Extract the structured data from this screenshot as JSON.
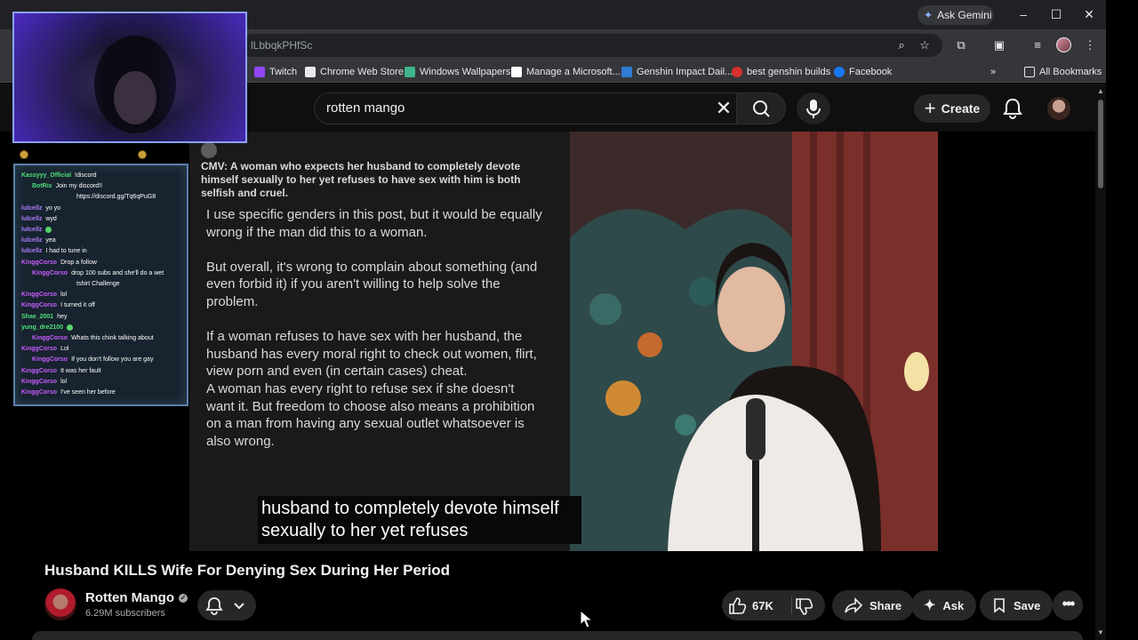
{
  "browser": {
    "url_fragment": "lLbbqkPHfSc",
    "ask_gemini_label": "Ask Gemini",
    "bookmarks": [
      "Twitch",
      "Chrome Web Store",
      "Windows Wallpapers",
      "Manage a Microsoft...",
      "Genshin Impact Dail...",
      "best genshin builds",
      "Facebook"
    ],
    "all_bookmarks_label": "All Bookmarks",
    "overflow_label": "»"
  },
  "youtube": {
    "search_query": "rotten mango",
    "create_label": "Create",
    "video": {
      "reddit_title": "CMV: A woman who expects her husband to completely devote himself sexually to her yet refuses to have sex with him is both selfish and cruel.",
      "reddit_paragraphs": [
        "I use specific genders in this post, but it would be equally wrong if the man did this to a woman.",
        "But overall, it's wrong to complain about something (and even forbid it) if you aren't willing to help solve the problem.",
        "If a woman refuses to have sex with her husband, the husband has every moral right to check out women, flirt, view porn and even (in certain cases) cheat.",
        "A woman has every right to refuse sex if she doesn't want it. But freedom to choose also means a prohibition on a man from having any sexual outlet whatsoever is also wrong."
      ],
      "caption_line1": "husband to completely devote himself",
      "caption_line2": "sexually to her yet refuses"
    },
    "title": "Husband KILLS Wife For Denying Sex During Her Period",
    "channel": {
      "name": "Rotten Mango",
      "subscribers": "6.29M subscribers"
    },
    "actions": {
      "likes": "67K",
      "share": "Share",
      "ask": "Ask",
      "save": "Save"
    }
  },
  "stream_chat": [
    {
      "user": "Kassyyy_Official",
      "text": "!discord",
      "color": "#4ee07a",
      "kind": "msg"
    },
    {
      "user": "BotRix",
      "text": "Join my discord!!",
      "color": "#4ee07a",
      "kind": "bot"
    },
    {
      "user": "",
      "text": "https://discord.gg/Tq6qPuG8",
      "color": "#ffffff",
      "kind": "cont"
    },
    {
      "user": "lulcellz",
      "text": "yo yo",
      "color": "#b07cff",
      "kind": "msg"
    },
    {
      "user": "lulcellz",
      "text": "wyd",
      "color": "#b07cff",
      "kind": "msg"
    },
    {
      "user": "lulcellz",
      "text": "",
      "color": "#b07cff",
      "kind": "emote"
    },
    {
      "user": "lulcellz",
      "text": "yea",
      "color": "#b07cff",
      "kind": "msg"
    },
    {
      "user": "lulcellz",
      "text": "I had to tune in",
      "color": "#b07cff",
      "kind": "msg"
    },
    {
      "user": "KinggCorso",
      "text": "Drop a follow",
      "color": "#c85cff",
      "kind": "msg"
    },
    {
      "user": "KinggCorso",
      "text": "drop 100 subs and she'll do a wet",
      "color": "#c85cff",
      "kind": "reply"
    },
    {
      "user": "",
      "text": "tshirt Challenge",
      "color": "#ffffff",
      "kind": "cont"
    },
    {
      "user": "KinggCorso",
      "text": "lol",
      "color": "#c85cff",
      "kind": "msg"
    },
    {
      "user": "KinggCorso",
      "text": "I turned it off",
      "color": "#c85cff",
      "kind": "msg"
    },
    {
      "user": "Shae_2001",
      "text": "hey",
      "color": "#4ee07a",
      "kind": "msg"
    },
    {
      "user": "yung_dre2100",
      "text": "",
      "color": "#4ee07a",
      "kind": "emote"
    },
    {
      "user": "KinggCorso",
      "text": "Whats this chink talking about",
      "color": "#c85cff",
      "kind": "reply"
    },
    {
      "user": "KinggCorso",
      "text": "Lol",
      "color": "#c85cff",
      "kind": "msg"
    },
    {
      "user": "KinggCorso",
      "text": "If you don't follow you are gay",
      "color": "#c85cff",
      "kind": "reply"
    },
    {
      "user": "KinggCorso",
      "text": "It was her fault",
      "color": "#c85cff",
      "kind": "msg"
    },
    {
      "user": "KinggCorso",
      "text": "lol",
      "color": "#c85cff",
      "kind": "msg"
    },
    {
      "user": "KinggCorso",
      "text": "I've seen her before",
      "color": "#c85cff",
      "kind": "msg"
    }
  ],
  "colors": {
    "youtube_bg": "#0f0f0f",
    "pill_bg": "#272727",
    "chrome_bg": "#35363a"
  }
}
